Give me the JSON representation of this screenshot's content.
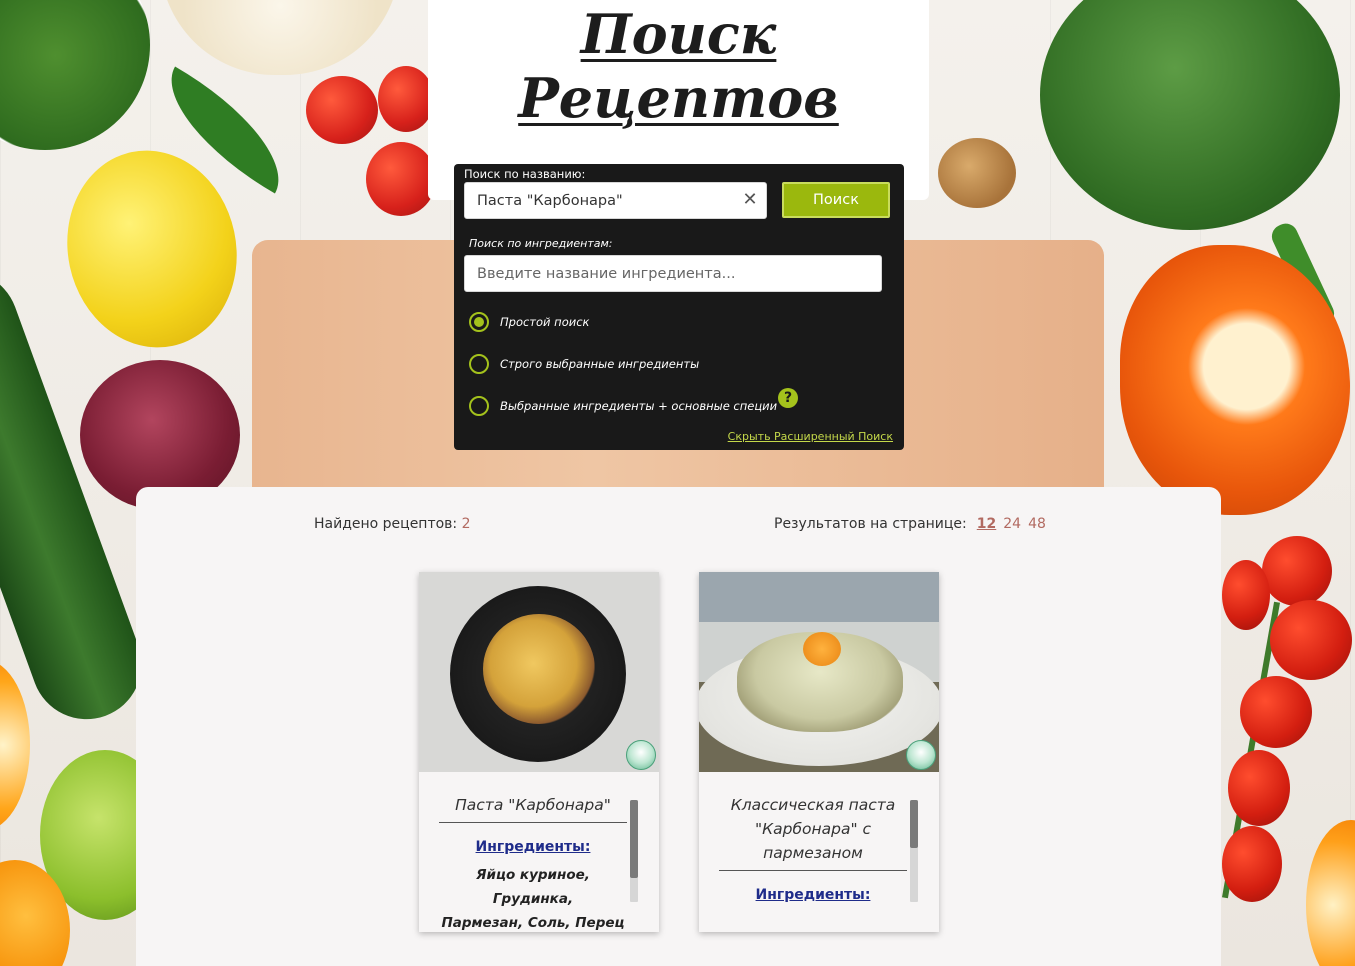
{
  "header": {
    "title_line1": "Поиск",
    "title_line2": "Рецептов"
  },
  "search": {
    "name_label": "Поиск по названию:",
    "name_value": "Паста \"Карбонара\"",
    "clear_icon": "close-icon",
    "search_button": "Поиск",
    "ingredients_label": "Поиск по ингредиентам:",
    "ingredients_placeholder": "Введите название ингредиента...",
    "modes": [
      {
        "label": "Простой поиск",
        "checked": true
      },
      {
        "label": "Строго выбранные ингредиенты",
        "checked": false
      },
      {
        "label": "Выбранные ингредиенты + основные специи",
        "checked": false
      }
    ],
    "help_icon": "?",
    "hide_advanced_link": "Скрыть Расширенный Поиск",
    "accent_color": "#9bb80d"
  },
  "results": {
    "found_label": "Найдено рецептов:",
    "found_count": "2",
    "per_page_label": "Результатов на странице:",
    "per_page_options": [
      "12",
      "24",
      "48"
    ],
    "per_page_selected": "12",
    "cards": [
      {
        "title": "Паста \"Карбонара\"",
        "ingredients_heading": "Ингредиенты:",
        "ingredients_line1": "Яйцо куриное, Грудинка,",
        "ingredients_line2": "Пармезан, Соль, Перец",
        "badge_icon": "chef-logo-icon"
      },
      {
        "title_line1": "Классическая паста",
        "title_line2": "\"Карбонара\" с",
        "title_line3": "пармезаном",
        "ingredients_heading": "Ингредиенты:",
        "badge_icon": "chef-logo-icon"
      }
    ]
  }
}
